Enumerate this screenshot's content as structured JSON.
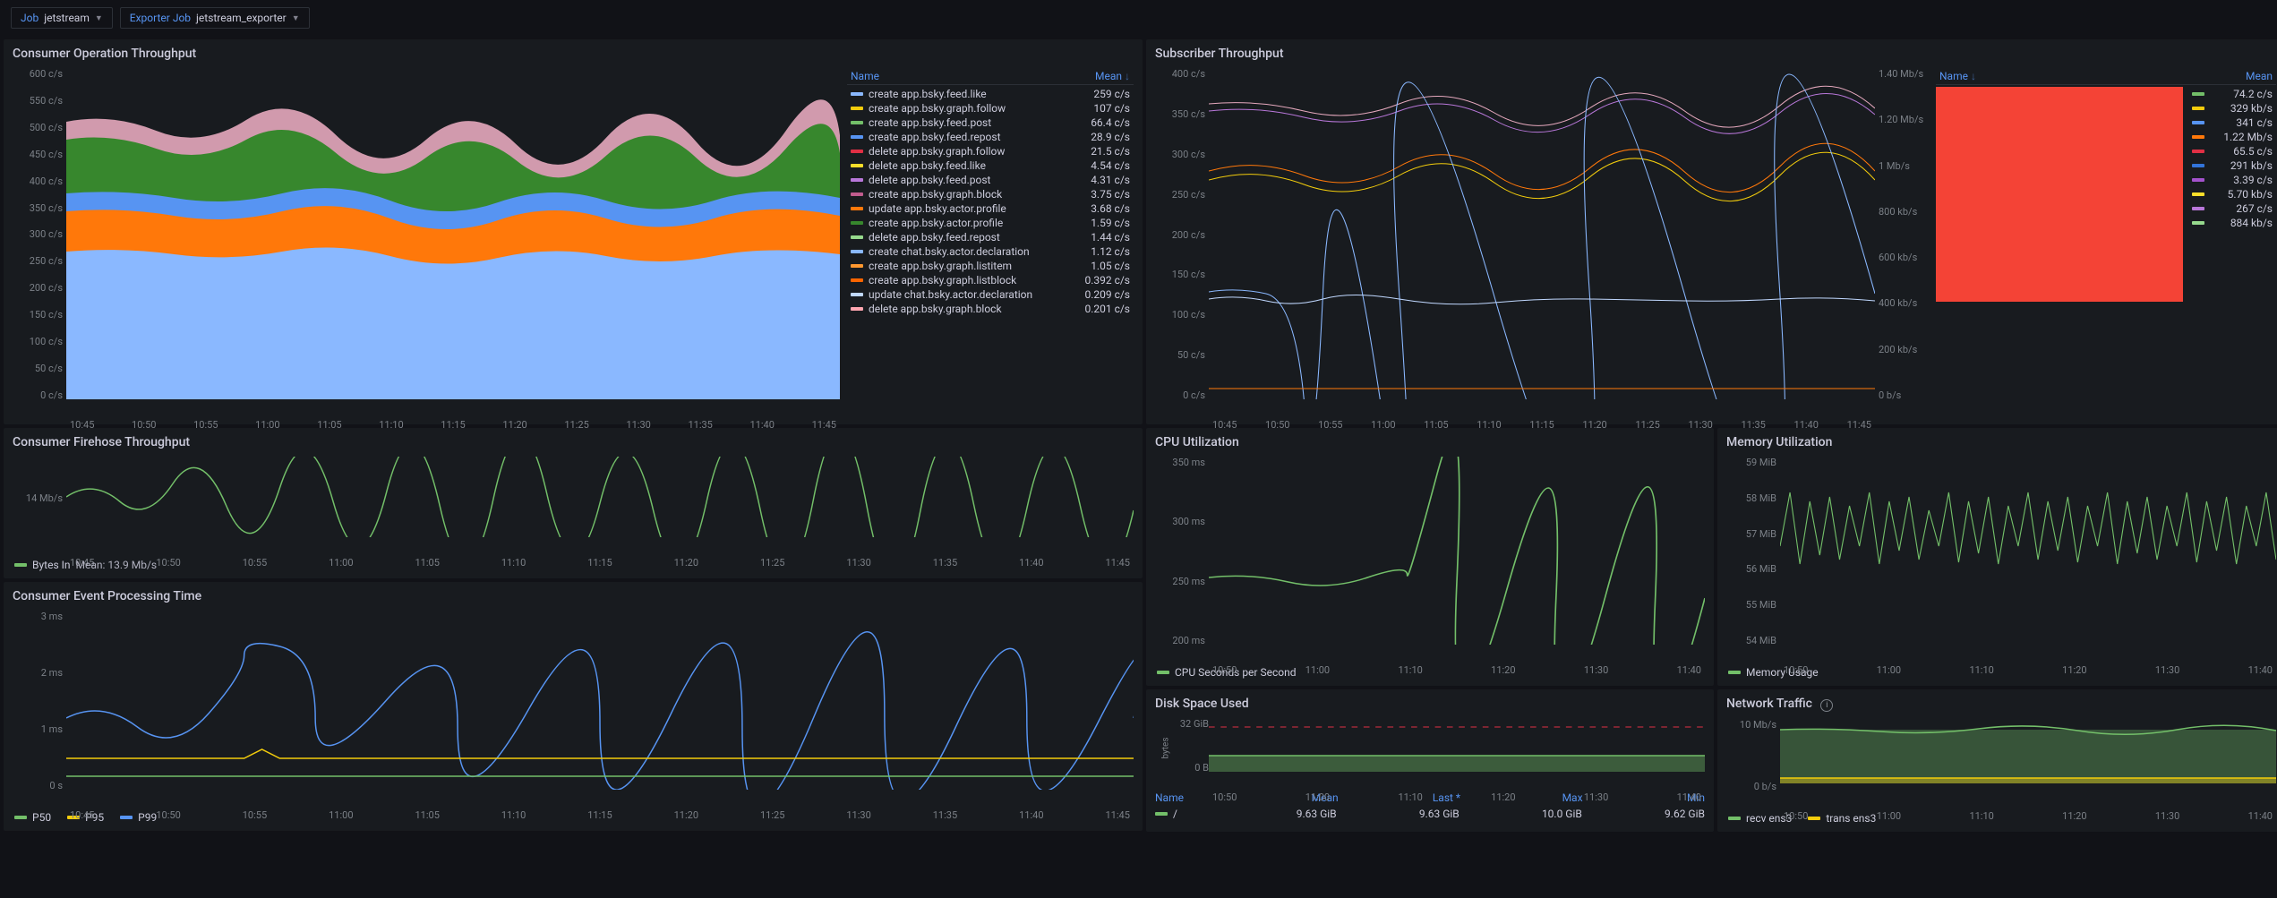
{
  "toolbar": {
    "job_label": "Job",
    "job_value": "jetstream",
    "exporter_label": "Exporter Job",
    "exporter_value": "jetstream_exporter"
  },
  "panels": {
    "consumer_op": {
      "title": "Consumer Operation Throughput",
      "legend_header_name": "Name",
      "legend_header_mean": "Mean"
    },
    "subscriber": {
      "title": "Subscriber Throughput",
      "legend_header_name": "Name",
      "legend_header_mean": "Mean"
    },
    "firehose": {
      "title": "Consumer Firehose Throughput",
      "bytes_in_label": "Bytes In",
      "bytes_in_mean": "Mean: 13.9 Mb/s"
    },
    "processing": {
      "title": "Consumer Event Processing Time",
      "p50": "P50",
      "p95": "P95",
      "p99": "P99"
    },
    "cpu": {
      "title": "CPU Utilization",
      "series_label": "CPU Seconds per Second"
    },
    "memory": {
      "title": "Memory Utilization",
      "series_label": "Memory Usage"
    },
    "disk": {
      "title": "Disk Space Used",
      "h_name": "Name",
      "h_mean": "Mean",
      "h_last": "Last *",
      "h_max": "Max",
      "h_min": "Min",
      "row_name": "/",
      "row_mean": "9.63 GiB",
      "row_last": "9.63 GiB",
      "row_max": "10.0 GiB",
      "row_min": "9.62 GiB"
    },
    "network": {
      "title": "Network Traffic",
      "recv": "recv ens3",
      "trans": "trans ens3"
    }
  },
  "chart_data": [
    {
      "id": "consumer_op",
      "type": "area",
      "stacked": true,
      "x_ticks": [
        "10:45",
        "10:50",
        "10:55",
        "11:00",
        "11:05",
        "11:10",
        "11:15",
        "11:20",
        "11:25",
        "11:30",
        "11:35",
        "11:40",
        "11:45"
      ],
      "y_ticks": [
        "600 c/s",
        "550 c/s",
        "500 c/s",
        "450 c/s",
        "400 c/s",
        "350 c/s",
        "300 c/s",
        "250 c/s",
        "200 c/s",
        "150 c/s",
        "100 c/s",
        "50 c/s",
        "0 c/s"
      ],
      "ylim": [
        0,
        600
      ],
      "series": [
        {
          "name": "create app.bsky.feed.like",
          "mean": "259 c/s",
          "color": "#8ab8ff"
        },
        {
          "name": "create app.bsky.graph.follow",
          "mean": "107 c/s",
          "color": "#f2cc0c"
        },
        {
          "name": "create app.bsky.feed.post",
          "mean": "66.4 c/s",
          "color": "#73bf69"
        },
        {
          "name": "create app.bsky.feed.repost",
          "mean": "28.9 c/s",
          "color": "#5794f2"
        },
        {
          "name": "delete app.bsky.graph.follow",
          "mean": "21.5 c/s",
          "color": "#e02f44"
        },
        {
          "name": "delete app.bsky.feed.like",
          "mean": "4.54 c/s",
          "color": "#fade2a"
        },
        {
          "name": "delete app.bsky.feed.post",
          "mean": "4.31 c/s",
          "color": "#b877d9"
        },
        {
          "name": "create app.bsky.graph.block",
          "mean": "3.75 c/s",
          "color": "#c15c8e"
        },
        {
          "name": "update app.bsky.actor.profile",
          "mean": "3.68 c/s",
          "color": "#ff780a"
        },
        {
          "name": "create app.bsky.actor.profile",
          "mean": "1.59 c/s",
          "color": "#37872d"
        },
        {
          "name": "delete app.bsky.feed.repost",
          "mean": "1.44 c/s",
          "color": "#96d98d"
        },
        {
          "name": "create chat.bsky.actor.declaration",
          "mean": "1.12 c/s",
          "color": "#8ab8ff"
        },
        {
          "name": "create app.bsky.graph.listitem",
          "mean": "1.05 c/s",
          "color": "#ff9830"
        },
        {
          "name": "create app.bsky.graph.listblock",
          "mean": "0.392 c/s",
          "color": "#fa6400"
        },
        {
          "name": "update chat.bsky.actor.declaration",
          "mean": "0.209 c/s",
          "color": "#c0d8ff"
        },
        {
          "name": "delete app.bsky.graph.block",
          "mean": "0.201 c/s",
          "color": "#ffa6b0"
        }
      ]
    },
    {
      "id": "subscriber",
      "type": "line",
      "x_ticks": [
        "10:45",
        "10:50",
        "10:55",
        "11:00",
        "11:05",
        "11:10",
        "11:15",
        "11:20",
        "11:25",
        "11:30",
        "11:35",
        "11:40",
        "11:45"
      ],
      "y_ticks_left": [
        "400 c/s",
        "350 c/s",
        "300 c/s",
        "250 c/s",
        "200 c/s",
        "150 c/s",
        "100 c/s",
        "50 c/s",
        "0 c/s"
      ],
      "y_ticks_right": [
        "1.40 Mb/s",
        "1.20 Mb/s",
        "1 Mb/s",
        "800 kb/s",
        "600 kb/s",
        "400 kb/s",
        "200 kb/s",
        "0 b/s"
      ],
      "series": [
        {
          "name": "",
          "mean": "74.2 c/s",
          "color": "#73bf69"
        },
        {
          "name": "",
          "mean": "329 kb/s",
          "color": "#f2cc0c"
        },
        {
          "name": "",
          "mean": "341 c/s",
          "color": "#5794f2"
        },
        {
          "name": "",
          "mean": "1.22 Mb/s",
          "color": "#ff780a"
        },
        {
          "name": "",
          "mean": "65.5 c/s",
          "color": "#e02f44"
        },
        {
          "name": "",
          "mean": "291 kb/s",
          "color": "#3274d9"
        },
        {
          "name": "",
          "mean": "3.39 c/s",
          "color": "#a352cc"
        },
        {
          "name": "",
          "mean": "5.70 kb/s",
          "color": "#fade2a"
        },
        {
          "name": "",
          "mean": "267 c/s",
          "color": "#b877d9"
        },
        {
          "name": "",
          "mean": "884 kb/s",
          "color": "#96d98d"
        }
      ]
    },
    {
      "id": "firehose",
      "type": "line",
      "x_ticks": [
        "10:45",
        "10:50",
        "10:55",
        "11:00",
        "11:05",
        "11:10",
        "11:15",
        "11:20",
        "11:25",
        "11:30",
        "11:35",
        "11:40",
        "11:45"
      ],
      "y_ticks": [
        "14 Mb/s"
      ],
      "series": [
        {
          "name": "Bytes In",
          "mean": "13.9 Mb/s",
          "color": "#73bf69"
        }
      ]
    },
    {
      "id": "processing",
      "type": "line",
      "x_ticks": [
        "10:45",
        "10:50",
        "10:55",
        "11:00",
        "11:05",
        "11:10",
        "11:15",
        "11:20",
        "11:25",
        "11:30",
        "11:35",
        "11:40",
        "11:45"
      ],
      "y_ticks": [
        "3 ms",
        "2 ms",
        "1 ms",
        "0 s"
      ],
      "series": [
        {
          "name": "P50",
          "color": "#73bf69"
        },
        {
          "name": "P95",
          "color": "#f2cc0c"
        },
        {
          "name": "P99",
          "color": "#5794f2"
        }
      ]
    },
    {
      "id": "cpu",
      "type": "line",
      "x_ticks": [
        "10:50",
        "11:00",
        "11:10",
        "11:20",
        "11:30",
        "11:40"
      ],
      "y_ticks": [
        "350 ms",
        "300 ms",
        "250 ms",
        "200 ms"
      ],
      "series": [
        {
          "name": "CPU Seconds per Second",
          "color": "#73bf69"
        }
      ]
    },
    {
      "id": "memory",
      "type": "line",
      "x_ticks": [
        "10:50",
        "11:00",
        "11:10",
        "11:20",
        "11:30",
        "11:40"
      ],
      "y_ticks": [
        "59 MiB",
        "58 MiB",
        "57 MiB",
        "56 MiB",
        "55 MiB",
        "54 MiB"
      ],
      "series": [
        {
          "name": "Memory Usage",
          "color": "#73bf69"
        }
      ]
    },
    {
      "id": "disk",
      "type": "area",
      "x_ticks": [
        "10:50",
        "11:00",
        "11:10",
        "11:20",
        "11:30",
        "11:40"
      ],
      "y_ticks": [
        "32 GiB",
        "0 B"
      ],
      "series": [
        {
          "name": "/",
          "mean": "9.63 GiB",
          "last": "9.63 GiB",
          "max": "10.0 GiB",
          "min": "9.62 GiB",
          "color": "#73bf69"
        }
      ]
    },
    {
      "id": "network",
      "type": "area",
      "x_ticks": [
        "10:50",
        "11:00",
        "11:10",
        "11:20",
        "11:30",
        "11:40"
      ],
      "y_ticks": [
        "10 Mb/s",
        "0 b/s"
      ],
      "series": [
        {
          "name": "recv ens3",
          "color": "#73bf69"
        },
        {
          "name": "trans ens3",
          "color": "#f2cc0c"
        }
      ]
    }
  ]
}
